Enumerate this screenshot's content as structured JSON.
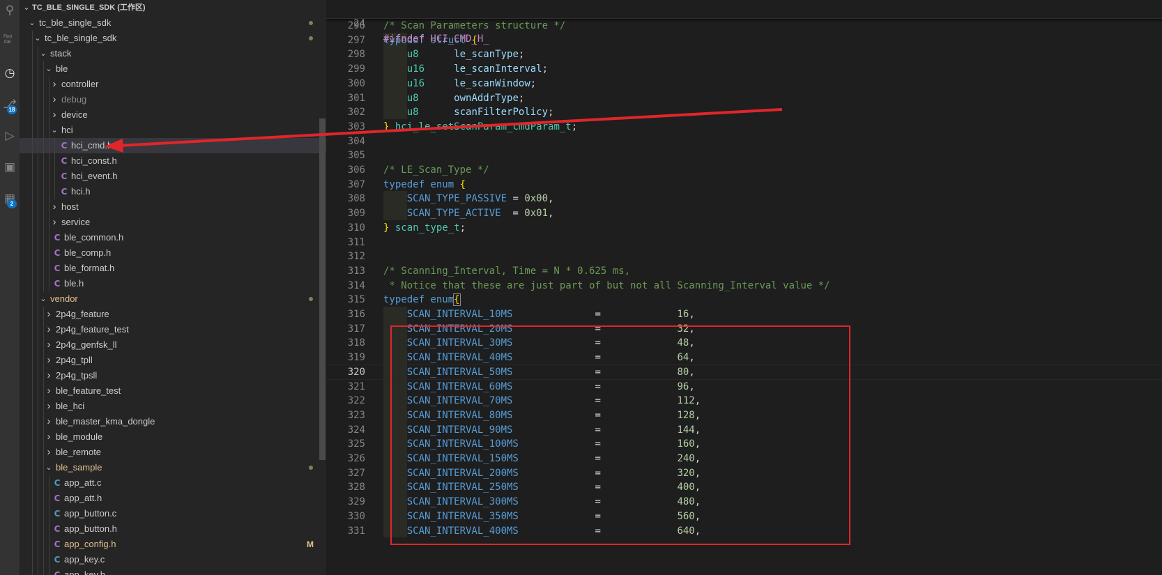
{
  "activity_bar": {
    "badges": {
      "source_control": "18",
      "extensions": "2"
    },
    "cloud_label_top": "Find",
    "cloud_label_bottom": "IDE"
  },
  "sidebar": {
    "workspace_title": "TC_BLE_SINGLE_SDK (工作区)",
    "tree": [
      {
        "label": "tc_ble_single_sdk",
        "depth": 0,
        "type": "folder",
        "open": true,
        "dot": true
      },
      {
        "label": "tc_ble_single_sdk",
        "depth": 1,
        "type": "folder",
        "open": true,
        "dot": true
      },
      {
        "label": "stack",
        "depth": 2,
        "type": "folder",
        "open": true
      },
      {
        "label": "ble",
        "depth": 3,
        "type": "folder",
        "open": true
      },
      {
        "label": "controller",
        "depth": 4,
        "type": "folder",
        "open": false
      },
      {
        "label": "debug",
        "depth": 4,
        "type": "folder",
        "open": false,
        "dim": true
      },
      {
        "label": "device",
        "depth": 4,
        "type": "folder",
        "open": false
      },
      {
        "label": "hci",
        "depth": 4,
        "type": "folder",
        "open": true
      },
      {
        "label": "hci_cmd.h",
        "depth": 5,
        "type": "h",
        "selected": true
      },
      {
        "label": "hci_const.h",
        "depth": 5,
        "type": "h"
      },
      {
        "label": "hci_event.h",
        "depth": 5,
        "type": "h"
      },
      {
        "label": "hci.h",
        "depth": 5,
        "type": "h"
      },
      {
        "label": "host",
        "depth": 4,
        "type": "folder",
        "open": false
      },
      {
        "label": "service",
        "depth": 4,
        "type": "folder",
        "open": false
      },
      {
        "label": "ble_common.h",
        "depth": 4,
        "type": "h",
        "noTwisty": true
      },
      {
        "label": "ble_comp.h",
        "depth": 4,
        "type": "h",
        "noTwisty": true
      },
      {
        "label": "ble_format.h",
        "depth": 4,
        "type": "h",
        "noTwisty": true
      },
      {
        "label": "ble.h",
        "depth": 4,
        "type": "h",
        "noTwisty": true
      },
      {
        "label": "vendor",
        "depth": 2,
        "type": "folder",
        "open": true,
        "mod": true,
        "dot": true
      },
      {
        "label": "2p4g_feature",
        "depth": 3,
        "type": "folder",
        "open": false
      },
      {
        "label": "2p4g_feature_test",
        "depth": 3,
        "type": "folder",
        "open": false
      },
      {
        "label": "2p4g_genfsk_ll",
        "depth": 3,
        "type": "folder",
        "open": false
      },
      {
        "label": "2p4g_tpll",
        "depth": 3,
        "type": "folder",
        "open": false
      },
      {
        "label": "2p4g_tpsll",
        "depth": 3,
        "type": "folder",
        "open": false
      },
      {
        "label": "ble_feature_test",
        "depth": 3,
        "type": "folder",
        "open": false
      },
      {
        "label": "ble_hci",
        "depth": 3,
        "type": "folder",
        "open": false
      },
      {
        "label": "ble_master_kma_dongle",
        "depth": 3,
        "type": "folder",
        "open": false
      },
      {
        "label": "ble_module",
        "depth": 3,
        "type": "folder",
        "open": false
      },
      {
        "label": "ble_remote",
        "depth": 3,
        "type": "folder",
        "open": false
      },
      {
        "label": "ble_sample",
        "depth": 3,
        "type": "folder",
        "open": true,
        "mod": true,
        "dot": true
      },
      {
        "label": "app_att.c",
        "depth": 4,
        "type": "c",
        "noTwisty": true
      },
      {
        "label": "app_att.h",
        "depth": 4,
        "type": "h",
        "noTwisty": true
      },
      {
        "label": "app_button.c",
        "depth": 4,
        "type": "c",
        "noTwisty": true
      },
      {
        "label": "app_button.h",
        "depth": 4,
        "type": "h",
        "noTwisty": true
      },
      {
        "label": "app_config.h",
        "depth": 4,
        "type": "h",
        "noTwisty": true,
        "mod": true,
        "flag": "M"
      },
      {
        "label": "app_key.c",
        "depth": 4,
        "type": "c",
        "noTwisty": true
      },
      {
        "label": "app_key.h",
        "depth": 4,
        "type": "h",
        "noTwisty": true
      }
    ]
  },
  "editor": {
    "sticky": {
      "line": "24",
      "text": "#ifndef HCI_CMD_H_"
    },
    "current_line": "320",
    "lines": [
      {
        "n": "296",
        "t": [
          [
            "cm",
            "/* Scan Parameters structure */"
          ]
        ]
      },
      {
        "n": "297",
        "t": [
          [
            "kw",
            "typedef"
          ],
          [
            "",
            " "
          ],
          [
            "kw",
            "struct"
          ],
          [
            "",
            " "
          ],
          [
            "br",
            "{"
          ]
        ]
      },
      {
        "n": "298",
        "t": [
          [
            "",
            "    "
          ],
          [
            "ty",
            "u8"
          ],
          [
            "",
            "      "
          ],
          [
            "id",
            "le_scanType"
          ],
          [
            "",
            ";"
          ]
        ]
      },
      {
        "n": "299",
        "t": [
          [
            "",
            "    "
          ],
          [
            "ty",
            "u16"
          ],
          [
            "",
            "     "
          ],
          [
            "id",
            "le_scanInterval"
          ],
          [
            "",
            ";"
          ]
        ]
      },
      {
        "n": "300",
        "t": [
          [
            "",
            "    "
          ],
          [
            "ty",
            "u16"
          ],
          [
            "",
            "     "
          ],
          [
            "id",
            "le_scanWindow"
          ],
          [
            "",
            ";"
          ]
        ]
      },
      {
        "n": "301",
        "t": [
          [
            "",
            "    "
          ],
          [
            "ty",
            "u8"
          ],
          [
            "",
            "      "
          ],
          [
            "id",
            "ownAddrType"
          ],
          [
            "",
            ";"
          ]
        ]
      },
      {
        "n": "302",
        "t": [
          [
            "",
            "    "
          ],
          [
            "ty",
            "u8"
          ],
          [
            "",
            "      "
          ],
          [
            "id",
            "scanFilterPolicy"
          ],
          [
            "",
            ";"
          ]
        ]
      },
      {
        "n": "303",
        "t": [
          [
            "br",
            "}"
          ],
          [
            "",
            " "
          ],
          [
            "ty",
            "hci_le_setScanParam_cmdParam_t"
          ],
          [
            "",
            ";"
          ]
        ]
      },
      {
        "n": "304",
        "t": []
      },
      {
        "n": "305",
        "t": []
      },
      {
        "n": "306",
        "t": [
          [
            "cm",
            "/* LE_Scan_Type */"
          ]
        ]
      },
      {
        "n": "307",
        "t": [
          [
            "kw",
            "typedef"
          ],
          [
            "",
            " "
          ],
          [
            "kw",
            "enum"
          ],
          [
            "",
            " "
          ],
          [
            "br",
            "{"
          ]
        ]
      },
      {
        "n": "308",
        "t": [
          [
            "",
            "    "
          ],
          [
            "mac",
            "SCAN_TYPE_PASSIVE"
          ],
          [
            "",
            " = "
          ],
          [
            "num",
            "0x00"
          ],
          [
            "",
            ","
          ]
        ]
      },
      {
        "n": "309",
        "t": [
          [
            "",
            "    "
          ],
          [
            "mac",
            "SCAN_TYPE_ACTIVE"
          ],
          [
            "",
            "  = "
          ],
          [
            "num",
            "0x01"
          ],
          [
            "",
            ","
          ]
        ]
      },
      {
        "n": "310",
        "t": [
          [
            "br",
            "}"
          ],
          [
            "",
            " "
          ],
          [
            "ty",
            "scan_type_t"
          ],
          [
            "",
            ";"
          ]
        ]
      },
      {
        "n": "311",
        "t": []
      },
      {
        "n": "312",
        "t": []
      },
      {
        "n": "313",
        "t": [
          [
            "cm",
            "/* Scanning_Interval, Time = N * 0.625 ms,"
          ]
        ]
      },
      {
        "n": "314",
        "t": [
          [
            "cm",
            " * Notice that these are just part of but not all Scanning_Interval value */"
          ]
        ]
      },
      {
        "n": "315",
        "t": [
          [
            "kw",
            "typedef"
          ],
          [
            "",
            " "
          ],
          [
            "kw",
            "enum"
          ],
          [
            "brm",
            "{"
          ]
        ]
      },
      {
        "n": "316",
        "t": [
          [
            "",
            "    "
          ],
          [
            "mac",
            "SCAN_INTERVAL_10MS"
          ],
          [
            "",
            "              =             "
          ],
          [
            "num",
            "16"
          ],
          [
            "",
            ","
          ]
        ]
      },
      {
        "n": "317",
        "t": [
          [
            "",
            "    "
          ],
          [
            "mac",
            "SCAN_INTERVAL_20MS"
          ],
          [
            "",
            "              =             "
          ],
          [
            "num",
            "32"
          ],
          [
            "",
            ","
          ]
        ]
      },
      {
        "n": "318",
        "t": [
          [
            "",
            "    "
          ],
          [
            "mac",
            "SCAN_INTERVAL_30MS"
          ],
          [
            "",
            "              =             "
          ],
          [
            "num",
            "48"
          ],
          [
            "",
            ","
          ]
        ]
      },
      {
        "n": "319",
        "t": [
          [
            "",
            "    "
          ],
          [
            "mac",
            "SCAN_INTERVAL_40MS"
          ],
          [
            "",
            "              =             "
          ],
          [
            "num",
            "64"
          ],
          [
            "",
            ","
          ]
        ]
      },
      {
        "n": "320",
        "t": [
          [
            "",
            "    "
          ],
          [
            "mac",
            "SCAN_INTERVAL_50MS"
          ],
          [
            "",
            "              =             "
          ],
          [
            "num",
            "80"
          ],
          [
            "",
            ","
          ]
        ]
      },
      {
        "n": "321",
        "t": [
          [
            "",
            "    "
          ],
          [
            "mac",
            "SCAN_INTERVAL_60MS"
          ],
          [
            "",
            "              =             "
          ],
          [
            "num",
            "96"
          ],
          [
            "",
            ","
          ]
        ]
      },
      {
        "n": "322",
        "t": [
          [
            "",
            "    "
          ],
          [
            "mac",
            "SCAN_INTERVAL_70MS"
          ],
          [
            "",
            "              =             "
          ],
          [
            "num",
            "112"
          ],
          [
            "",
            ","
          ]
        ]
      },
      {
        "n": "323",
        "t": [
          [
            "",
            "    "
          ],
          [
            "mac",
            "SCAN_INTERVAL_80MS"
          ],
          [
            "",
            "              =             "
          ],
          [
            "num",
            "128"
          ],
          [
            "",
            ","
          ]
        ]
      },
      {
        "n": "324",
        "t": [
          [
            "",
            "    "
          ],
          [
            "mac",
            "SCAN_INTERVAL_90MS"
          ],
          [
            "",
            "              =             "
          ],
          [
            "num",
            "144"
          ],
          [
            "",
            ","
          ]
        ]
      },
      {
        "n": "325",
        "t": [
          [
            "",
            "    "
          ],
          [
            "mac",
            "SCAN_INTERVAL_100MS"
          ],
          [
            "",
            "             =             "
          ],
          [
            "num",
            "160"
          ],
          [
            "",
            ","
          ]
        ]
      },
      {
        "n": "326",
        "t": [
          [
            "",
            "    "
          ],
          [
            "mac",
            "SCAN_INTERVAL_150MS"
          ],
          [
            "",
            "             =             "
          ],
          [
            "num",
            "240"
          ],
          [
            "",
            ","
          ]
        ]
      },
      {
        "n": "327",
        "t": [
          [
            "",
            "    "
          ],
          [
            "mac",
            "SCAN_INTERVAL_200MS"
          ],
          [
            "",
            "             =             "
          ],
          [
            "num",
            "320"
          ],
          [
            "",
            ","
          ]
        ]
      },
      {
        "n": "328",
        "t": [
          [
            "",
            "    "
          ],
          [
            "mac",
            "SCAN_INTERVAL_250MS"
          ],
          [
            "",
            "             =             "
          ],
          [
            "num",
            "400"
          ],
          [
            "",
            ","
          ]
        ]
      },
      {
        "n": "329",
        "t": [
          [
            "",
            "    "
          ],
          [
            "mac",
            "SCAN_INTERVAL_300MS"
          ],
          [
            "",
            "             =             "
          ],
          [
            "num",
            "480"
          ],
          [
            "",
            ","
          ]
        ]
      },
      {
        "n": "330",
        "t": [
          [
            "",
            "    "
          ],
          [
            "mac",
            "SCAN_INTERVAL_350MS"
          ],
          [
            "",
            "             =             "
          ],
          [
            "num",
            "560"
          ],
          [
            "",
            ","
          ]
        ]
      },
      {
        "n": "331",
        "t": [
          [
            "",
            "    "
          ],
          [
            "mac",
            "SCAN_INTERVAL_400MS"
          ],
          [
            "",
            "             =             "
          ],
          [
            "num",
            "640"
          ],
          [
            "",
            ","
          ]
        ]
      }
    ]
  },
  "colors": {
    "annotation_red": "#e0262b",
    "sidebar_bg": "#252526",
    "editor_bg": "#1e1e1e",
    "activity_bg": "#333333"
  }
}
